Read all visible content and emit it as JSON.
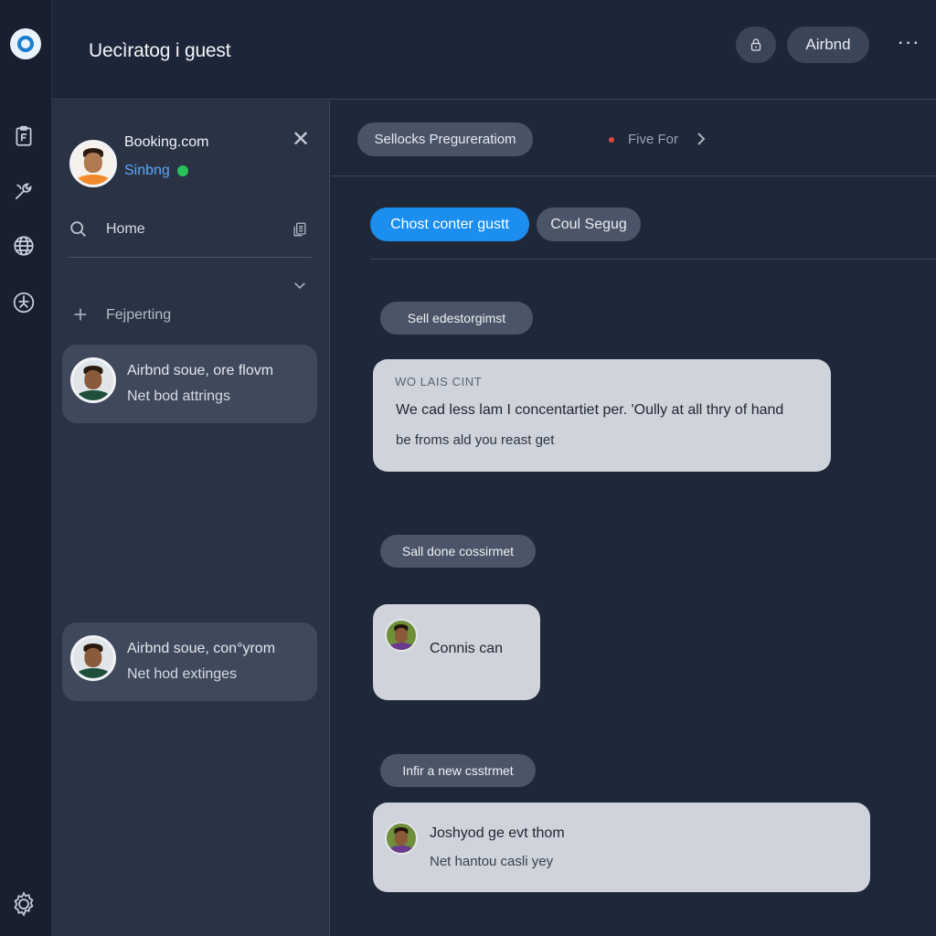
{
  "rail": {
    "icons": [
      "app-logo-icon",
      "clipboard-icon",
      "tools-icon",
      "globe-icon",
      "compass-icon",
      "settings-gear-icon"
    ]
  },
  "topbar": {
    "title": "Uecìratog i guest",
    "airbnd_label": "Airbnd",
    "more_label": "···"
  },
  "sidebar": {
    "account": {
      "name": "Booking.com",
      "status": "Sinbng",
      "status_color": "#27c35a"
    },
    "close_label": "✕",
    "search_label": "Home",
    "section_label": "Fejperting",
    "conversations": [
      {
        "line1": "Airbnd soue, ore flovm",
        "line2": "Net bod attrings"
      },
      {
        "line1": "Airbnd soue, con°yrom",
        "line2": "Net hod extinges"
      }
    ]
  },
  "main": {
    "breadcrumb": {
      "pill": "Sellocks Pregureratiom",
      "next": "Five For"
    },
    "tabs": [
      {
        "label": "Chost conter gustt",
        "active": true
      },
      {
        "label": "Coul Segug",
        "active": false
      }
    ],
    "accent_color": "#1b8ef0",
    "threads": [
      {
        "label": "Sell edestorgimst",
        "header": "WO LAIS CINT",
        "body_line1": "We cad less lam I concentartiet per. 'Oully at all thry of hand",
        "body_line2": "be froms ald you reast get"
      },
      {
        "label": "Sall done cossirmet",
        "name": "Connis can"
      },
      {
        "label": "Infir a new csstrmet",
        "name": "Joshyod ge evt thom",
        "sub": "Net hantou casli yey"
      }
    ]
  }
}
